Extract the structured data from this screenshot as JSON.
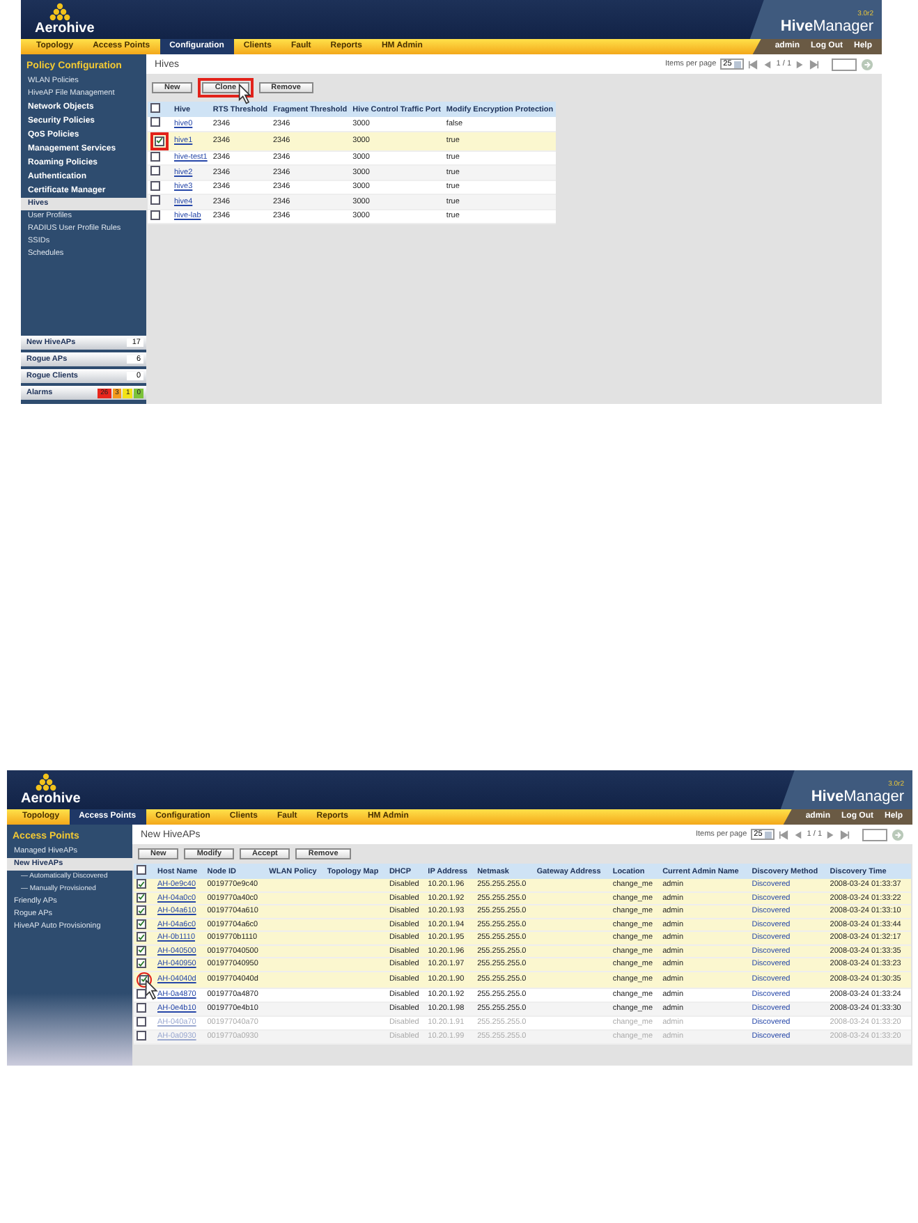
{
  "screens": [
    {
      "header": {
        "logo": "Aerohive",
        "product": "**Hive**Manager",
        "version": "3.0r2"
      },
      "nav_tabs": [
        {
          "label": "Topology",
          "selected": false
        },
        {
          "label": "Access Points",
          "selected": false
        },
        {
          "label": "Configuration",
          "selected": true
        },
        {
          "label": "Clients",
          "selected": false
        },
        {
          "label": "Fault",
          "selected": false
        },
        {
          "label": "Reports",
          "selected": false
        },
        {
          "label": "HM Admin",
          "selected": false
        }
      ],
      "user_links": [
        "admin",
        "Log Out",
        "Help"
      ],
      "sidebar": {
        "title": "Policy Configuration",
        "items": [
          {
            "label": "WLAN Policies",
            "kind": "link",
            "selected": false
          },
          {
            "label": "HiveAP File Management",
            "kind": "link",
            "selected": false
          },
          {
            "label": "Network Objects",
            "kind": "group",
            "selected": false
          },
          {
            "label": "Security Policies",
            "kind": "group",
            "selected": false
          },
          {
            "label": "QoS Policies",
            "kind": "group",
            "selected": false
          },
          {
            "label": "Management Services",
            "kind": "group",
            "selected": false
          },
          {
            "label": "Roaming Policies",
            "kind": "group",
            "selected": false
          },
          {
            "label": "Authentication",
            "kind": "group",
            "selected": false
          },
          {
            "label": "Certificate Manager",
            "kind": "group",
            "selected": false
          },
          {
            "label": "Hives",
            "kind": "link",
            "selected": true
          },
          {
            "label": "User Profiles",
            "kind": "link",
            "selected": false
          },
          {
            "label": "RADIUS User Profile Rules",
            "kind": "link",
            "selected": false
          },
          {
            "label": "SSIDs",
            "kind": "link",
            "selected": false
          },
          {
            "label": "Schedules",
            "kind": "link",
            "selected": false
          }
        ]
      },
      "status_panel": [
        {
          "kind": "count",
          "label": "New HiveAPs",
          "count": "17"
        },
        {
          "kind": "count",
          "label": "Rogue APs",
          "count": "6"
        },
        {
          "kind": "count",
          "label": "Rogue Clients",
          "count": "0"
        },
        {
          "kind": "alarms",
          "label": "Alarms",
          "counts": [
            {
              "value": "26",
              "color": "#e8261c"
            },
            {
              "value": "3",
              "color": "#f39a1c"
            },
            {
              "value": "1",
              "color": "#f2e318"
            },
            {
              "value": "0",
              "color": "#7cc23a"
            }
          ]
        }
      ],
      "page_title": "Hives",
      "items_per_page": {
        "label": "Items per page",
        "value": "25"
      },
      "pager": "1 / 1",
      "buttons": [
        {
          "label": "New"
        },
        {
          "label": "Clone",
          "boxed": true,
          "cursor": true
        },
        {
          "label": "Remove"
        }
      ],
      "table": {
        "select_all_checked": false,
        "columns": [
          "Hive",
          "RTS Threshold",
          "Fragment Threshold",
          "Hive Control Traffic Port",
          "Modify Encryption Protection"
        ],
        "rows": [
          {
            "checked": false,
            "cells": [
              "hive0",
              "2346",
              "2346",
              "3000",
              "false"
            ]
          },
          {
            "checked": true,
            "boxed": true,
            "cells": [
              "hive1",
              "2346",
              "2346",
              "3000",
              "true"
            ]
          },
          {
            "checked": false,
            "cells": [
              "hive-test1",
              "2346",
              "2346",
              "3000",
              "true"
            ]
          },
          {
            "checked": false,
            "cells": [
              "hive2",
              "2346",
              "2346",
              "3000",
              "true"
            ]
          },
          {
            "checked": false,
            "cells": [
              "hive3",
              "2346",
              "2346",
              "3000",
              "true"
            ]
          },
          {
            "checked": false,
            "cells": [
              "hive4",
              "2346",
              "2346",
              "3000",
              "true"
            ]
          },
          {
            "checked": false,
            "cells": [
              "hive-lab",
              "2346",
              "2346",
              "3000",
              "true"
            ]
          }
        ]
      }
    },
    {
      "header": {
        "logo": "Aerohive",
        "product": "**Hive**Manager",
        "version": "3.0r2"
      },
      "nav_tabs": [
        {
          "label": "Topology",
          "selected": false
        },
        {
          "label": "Access Points",
          "selected": true
        },
        {
          "label": "Configuration",
          "selected": false
        },
        {
          "label": "Clients",
          "selected": false
        },
        {
          "label": "Fault",
          "selected": false
        },
        {
          "label": "Reports",
          "selected": false
        },
        {
          "label": "HM Admin",
          "selected": false
        }
      ],
      "user_links": [
        "admin",
        "Log Out",
        "Help"
      ],
      "sidebar": {
        "title": "Access Points",
        "items": [
          {
            "label": "Managed HiveAPs",
            "kind": "link",
            "selected": false
          },
          {
            "label": "New HiveAPs",
            "kind": "link",
            "selected": true
          },
          {
            "label": "— Automatically Discovered",
            "kind": "sub",
            "selected": false
          },
          {
            "label": "— Manually Provisioned",
            "kind": "sub",
            "selected": false
          },
          {
            "label": "Friendly APs",
            "kind": "link",
            "selected": false
          },
          {
            "label": "Rogue APs",
            "kind": "link",
            "selected": false
          },
          {
            "label": "HiveAP Auto Provisioning",
            "kind": "link",
            "selected": false
          }
        ]
      },
      "page_title": "New HiveAPs",
      "items_per_page": {
        "label": "Items per page",
        "value": "25"
      },
      "pager": "1 / 1",
      "buttons": [
        {
          "label": "New"
        },
        {
          "label": "Modify"
        },
        {
          "label": "Accept"
        },
        {
          "label": "Remove"
        }
      ],
      "table": {
        "select_all_checked": false,
        "columns": [
          "Host Name",
          "Node ID",
          "WLAN Policy",
          "Topology Map",
          "DHCP",
          "IP Address",
          "Netmask",
          "Gateway Address",
          "Location",
          "Current Admin Name",
          "Discovery Method",
          "Discovery Time"
        ],
        "rows": [
          {
            "checked": true,
            "cells": [
              "AH-0e9c40",
              "0019770e9c40",
              null,
              null,
              "Disabled",
              "10.20.1.96",
              "255.255.255.0",
              null,
              "change_me",
              "admin",
              "Discovered",
              "2008-03-24 01:33:37"
            ]
          },
          {
            "checked": true,
            "cells": [
              "AH-04a0c0",
              "0019770a40c0",
              null,
              null,
              "Disabled",
              "10.20.1.92",
              "255.255.255.0",
              null,
              "change_me",
              "admin",
              "Discovered",
              "2008-03-24 01:33:22"
            ]
          },
          {
            "checked": true,
            "cells": [
              "AH-04a610",
              "00197704a610",
              null,
              null,
              "Disabled",
              "10.20.1.93",
              "255.255.255.0",
              null,
              "change_me",
              "admin",
              "Discovered",
              "2008-03-24 01:33:10"
            ]
          },
          {
            "checked": true,
            "cells": [
              "AH-04a6c0",
              "00197704a6c0",
              null,
              null,
              "Disabled",
              "10.20.1.94",
              "255.255.255.0",
              null,
              "change_me",
              "admin",
              "Discovered",
              "2008-03-24 01:33:44"
            ]
          },
          {
            "checked": true,
            "cells": [
              "AH-0b1110",
              "0019770b1110",
              null,
              null,
              "Disabled",
              "10.20.1.95",
              "255.255.255.0",
              null,
              "change_me",
              "admin",
              "Discovered",
              "2008-03-24 01:32:17"
            ]
          },
          {
            "checked": true,
            "cells": [
              "AH-040500",
              "001977040500",
              null,
              null,
              "Disabled",
              "10.20.1.96",
              "255.255.255.0",
              null,
              "change_me",
              "admin",
              "Discovered",
              "2008-03-24 01:33:35"
            ]
          },
          {
            "checked": true,
            "cells": [
              "AH-040950",
              "001977040950",
              null,
              null,
              "Disabled",
              "10.20.1.97",
              "255.255.255.0",
              null,
              "change_me",
              "admin",
              "Discovered",
              "2008-03-24 01:33:23"
            ]
          },
          {
            "checked": true,
            "circled": true,
            "cursor": true,
            "cells": [
              "AH-04040d",
              "00197704040d",
              null,
              null,
              "Disabled",
              "10.20.1.90",
              "255.255.255.0",
              null,
              "change_me",
              "admin",
              "Discovered",
              "2008-03-24 01:30:35"
            ]
          },
          {
            "checked": false,
            "cells": [
              "AH-0a4870",
              "0019770a4870",
              null,
              null,
              "Disabled",
              "10.20.1.92",
              "255.255.255.0",
              null,
              "change_me",
              "admin",
              "Discovered",
              "2008-03-24 01:33:24"
            ]
          },
          {
            "checked": false,
            "cells": [
              "AH-0e4b10",
              "0019770e4b10",
              null,
              null,
              "Disabled",
              "10.20.1.98",
              "255.255.255.0",
              null,
              "change_me",
              "admin",
              "Discovered",
              "2008-03-24 01:33:30"
            ]
          },
          {
            "checked": false,
            "faded": true,
            "cells": [
              "AH-040a70",
              "001977040a70",
              null,
              null,
              "Disabled",
              "10.20.1.91",
              "255.255.255.0",
              null,
              "change_me",
              "admin",
              "Discovered",
              "2008-03-24 01:33:20"
            ]
          },
          {
            "checked": false,
            "faded": true,
            "cells": [
              "AH-0a0930",
              "0019770a0930",
              null,
              null,
              "Disabled",
              "10.20.1.99",
              "255.255.255.0",
              null,
              "change_me",
              "admin",
              "Discovered",
              "2008-03-24 01:33:20"
            ]
          }
        ]
      }
    }
  ]
}
